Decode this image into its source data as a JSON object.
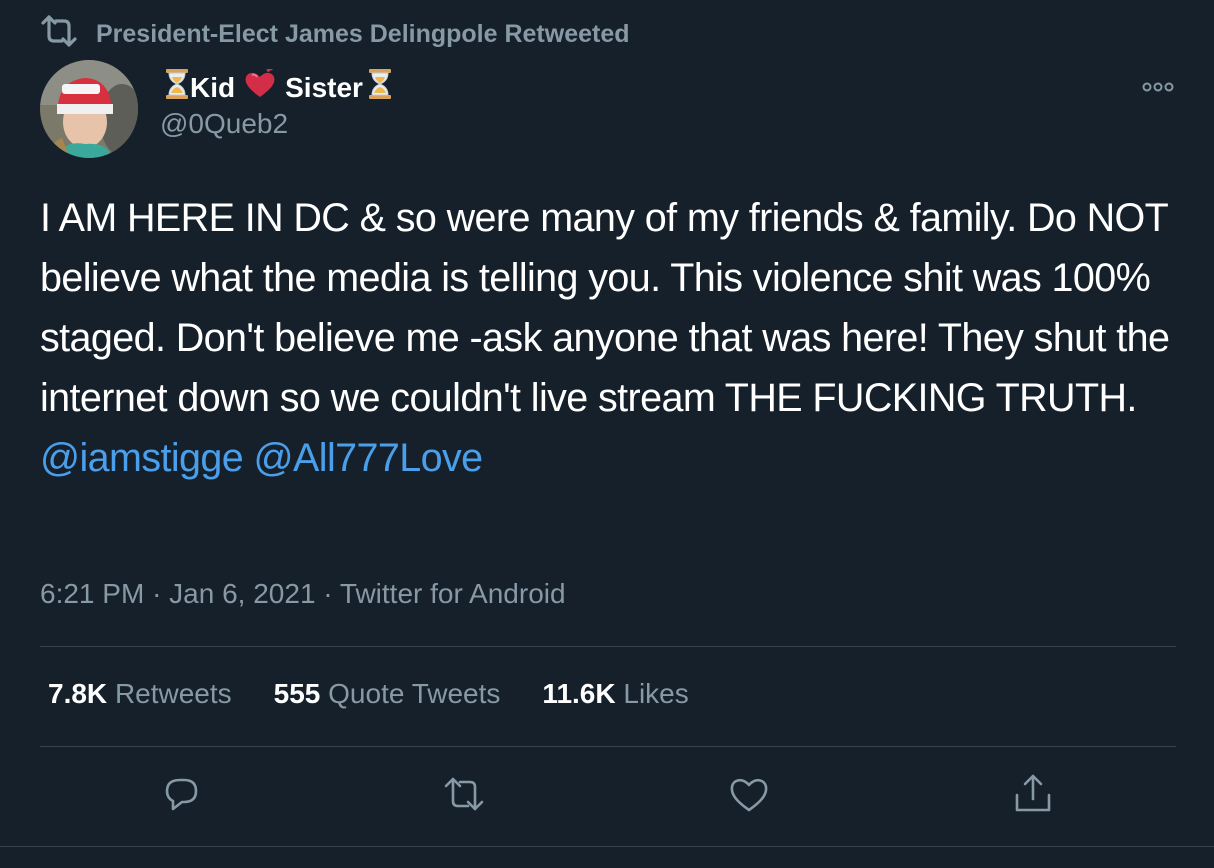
{
  "retweet_header": {
    "text": "President-Elect James Delingpole Retweeted"
  },
  "author": {
    "name_word_1": "Kid",
    "name_word_2": "Sister",
    "name_emoji_1": "hourglass-icon",
    "name_emoji_2": "heart-icon",
    "handle": "@0Queb2"
  },
  "tweet": {
    "text": "I AM HERE IN DC & so were many of my friends & family. Do NOT believe what the media is telling you. This violence shit was 100% staged. Don't believe me -ask anyone that was here! They shut the internet down so we couldn't live stream THE FUCKING TRUTH.",
    "mentions": [
      "@iamstigge",
      "@All777Love"
    ],
    "time": "6:21 PM",
    "sep": "·",
    "date": "Jan 6, 2021",
    "source": "Twitter for Android"
  },
  "stats": [
    {
      "value": "7.8K",
      "label": "Retweets"
    },
    {
      "value": "555",
      "label": "Quote Tweets"
    },
    {
      "value": "11.6K",
      "label": "Likes"
    }
  ],
  "actions": [
    "reply-icon",
    "retweet-icon",
    "like-icon",
    "share-icon"
  ],
  "colors": {
    "background": "#15202b",
    "primary_text": "#ffffff",
    "secondary_text": "#8899a6",
    "mention": "#4a9eea",
    "divider": "#38444d"
  }
}
